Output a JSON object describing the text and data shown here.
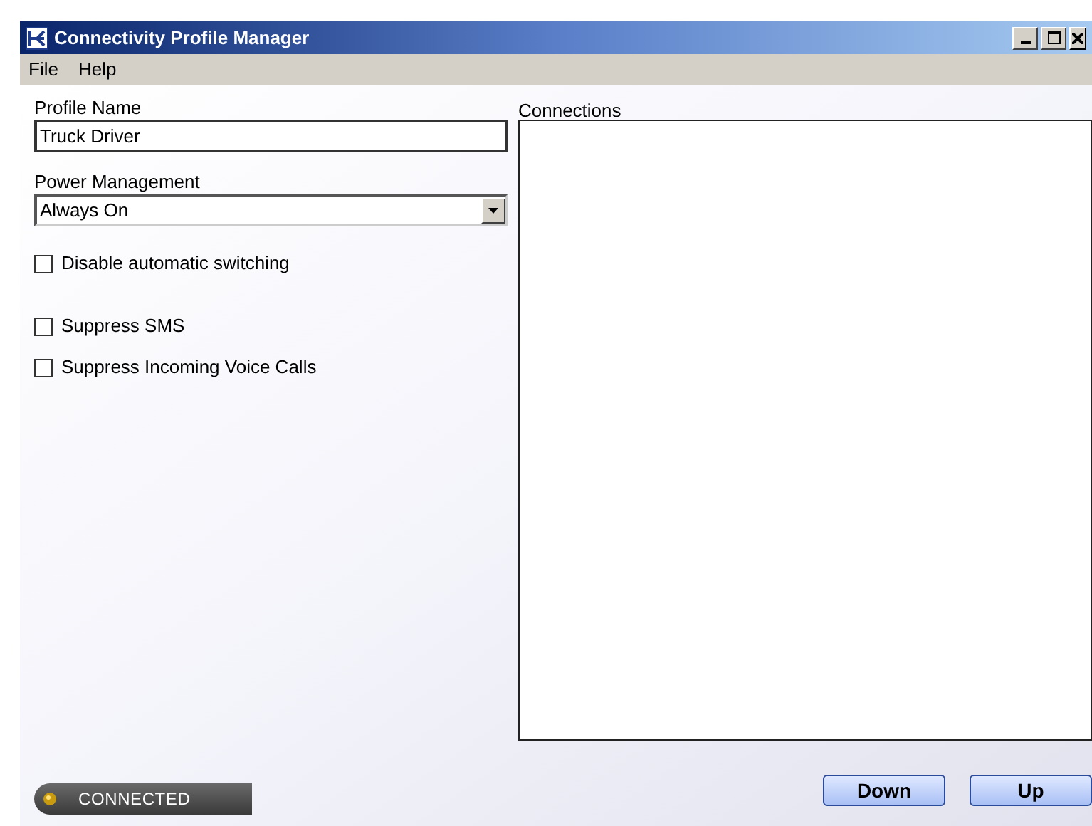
{
  "window": {
    "title": "Connectivity Profile Manager"
  },
  "menu": [
    "File",
    "Help"
  ],
  "profile_name": {
    "label": "Profile Name",
    "value": "Truck Driver"
  },
  "power_management": {
    "label": "Power Management",
    "value": "Always On"
  },
  "options": [
    {
      "label": "Disable automatic switching",
      "checked": false
    },
    {
      "label": "Suppress SMS",
      "checked": false
    },
    {
      "label": "Suppress Incoming Voice Calls",
      "checked": false
    }
  ],
  "connections": {
    "label": "Connections"
  },
  "status": {
    "text": "CONNECTED"
  },
  "buttons": [
    "Down",
    "Up"
  ]
}
